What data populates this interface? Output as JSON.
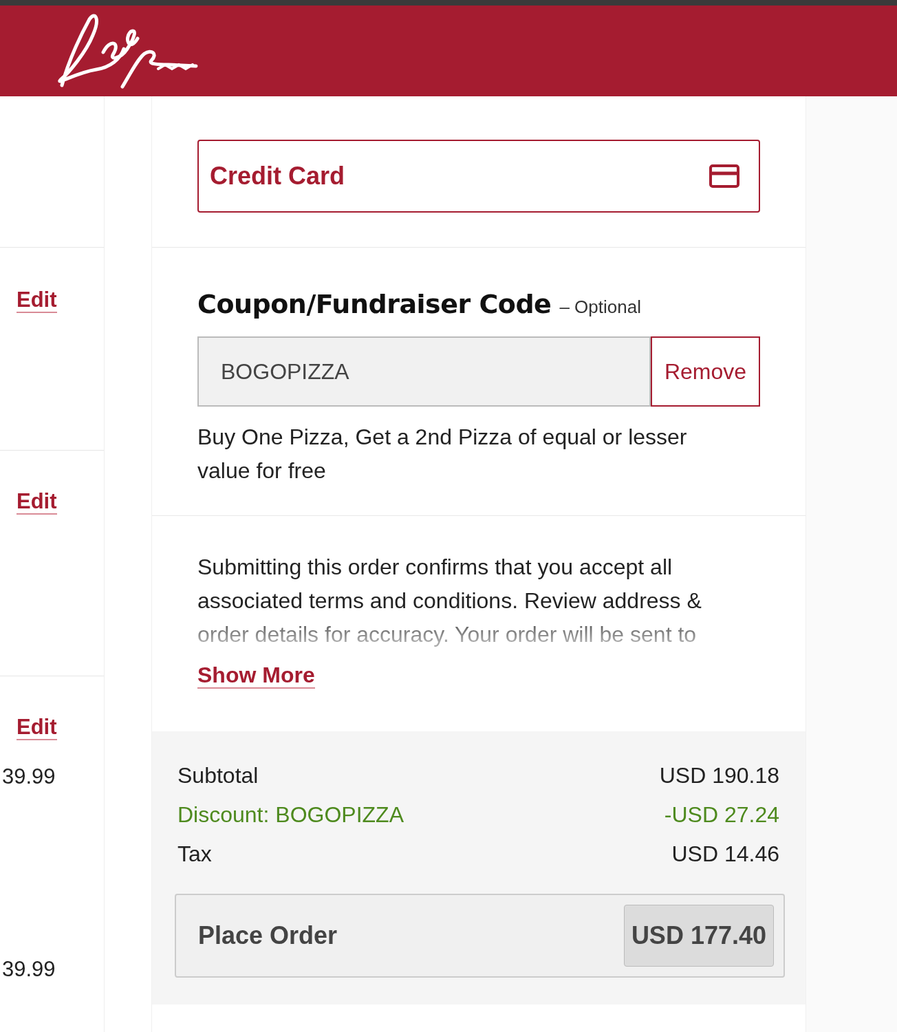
{
  "left_column": {
    "rows": [
      {
        "kind": "edit",
        "text": "Edit"
      },
      {
        "kind": "edit",
        "text": "Edit"
      },
      {
        "kind": "edit",
        "text": "Edit"
      },
      {
        "kind": "price",
        "text": "39.99"
      },
      {
        "kind": "price",
        "text": "39.99"
      }
    ]
  },
  "payment_method": {
    "label": "Credit Card"
  },
  "coupon": {
    "title": "Coupon/Fundraiser Code",
    "optional": "– Optional",
    "value": "BOGOPIZZA",
    "remove": "Remove",
    "description": "Buy One Pizza, Get a 2nd Pizza of equal or lesser value for free"
  },
  "terms": {
    "text": "Submitting this order confirms that you accept all associated terms and conditions. Review address & order details for accuracy. Your order will be sent to",
    "show_more": "Show More"
  },
  "summary": {
    "lines": [
      {
        "kind": "normal",
        "label": "Subtotal",
        "amount": "USD 190.18"
      },
      {
        "kind": "discount",
        "label": "Discount: BOGOPIZZA",
        "amount": "-USD 27.24"
      },
      {
        "kind": "normal",
        "label": "Tax",
        "amount": "USD 14.46"
      }
    ],
    "place_order": {
      "label": "Place Order",
      "total": "USD 177.40"
    }
  }
}
